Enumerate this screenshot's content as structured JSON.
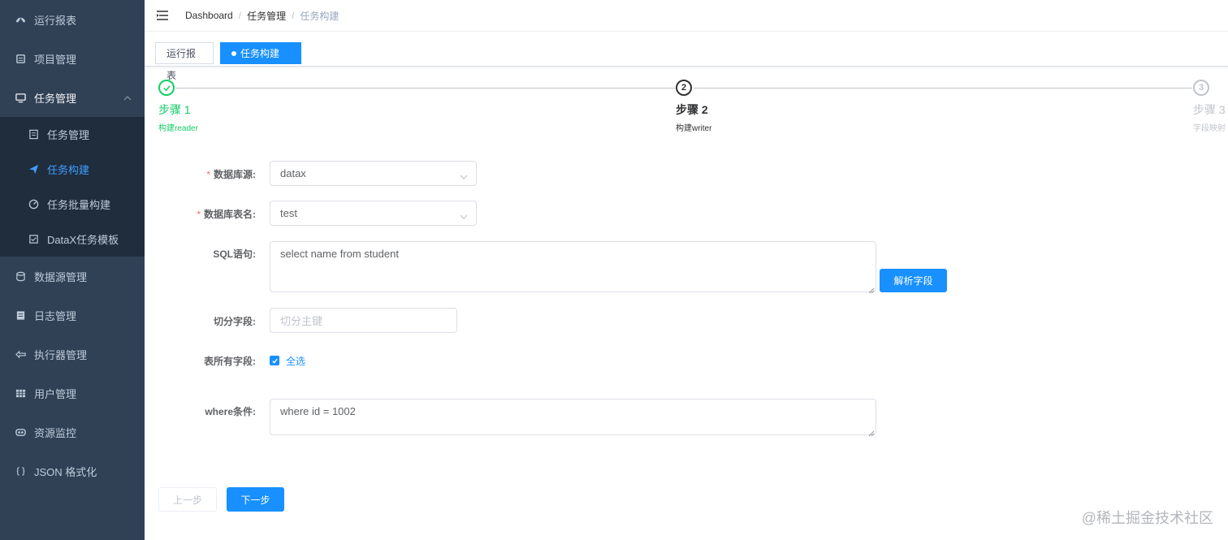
{
  "sidebar": {
    "items": [
      {
        "label": "运行报表",
        "icon": "dashboard-icon"
      },
      {
        "label": "项目管理",
        "icon": "project-icon"
      },
      {
        "label": "任务管理",
        "icon": "monitor-icon"
      },
      {
        "label": "数据源管理",
        "icon": "database-icon"
      },
      {
        "label": "日志管理",
        "icon": "log-icon"
      },
      {
        "label": "执行器管理",
        "icon": "executor-icon"
      },
      {
        "label": "用户管理",
        "icon": "user-grid-icon"
      },
      {
        "label": "资源监控",
        "icon": "monitor-link-icon"
      },
      {
        "label": "JSON 格式化",
        "icon": "braces-icon"
      }
    ],
    "submenu": [
      {
        "label": "任务管理",
        "icon": "list-icon"
      },
      {
        "label": "任务构建",
        "icon": "send-icon"
      },
      {
        "label": "任务批量构建",
        "icon": "batch-icon"
      },
      {
        "label": "DataX任务模板",
        "icon": "template-icon"
      }
    ]
  },
  "breadcrumb": {
    "items": [
      "Dashboard",
      "任务管理",
      "任务构建"
    ],
    "sep": "/"
  },
  "tags": {
    "items": [
      {
        "label": "运行报表"
      },
      {
        "label": "任务构建",
        "close": "×"
      }
    ]
  },
  "steps": [
    {
      "num": "1",
      "title": "步骤 1",
      "desc": "构建reader",
      "status": "done"
    },
    {
      "num": "2",
      "title": "步骤 2",
      "desc": "构建writer",
      "status": "process"
    },
    {
      "num": "3",
      "title": "步骤 3",
      "desc": "字段映射",
      "status": "wait"
    }
  ],
  "form": {
    "datasource": {
      "label": "数据库源:",
      "value": "datax"
    },
    "table": {
      "label": "数据库表名:",
      "value": "test"
    },
    "sql": {
      "label": "SQL语句:",
      "value": "select name from student"
    },
    "parse_button": "解析字段",
    "split": {
      "label": "切分字段:",
      "placeholder": "切分主键"
    },
    "fields": {
      "label": "表所有字段:",
      "check_label": "全选"
    },
    "where": {
      "label": "where条件:",
      "value": "where id = 1002"
    }
  },
  "buttons": {
    "prev": "上一步",
    "next": "下一步"
  },
  "watermark": "@稀土掘金技术社区",
  "colors": {
    "sidebar": "#304156",
    "submenu": "#1f2d3d",
    "primary": "#1890ff",
    "success": "#13ce66"
  }
}
